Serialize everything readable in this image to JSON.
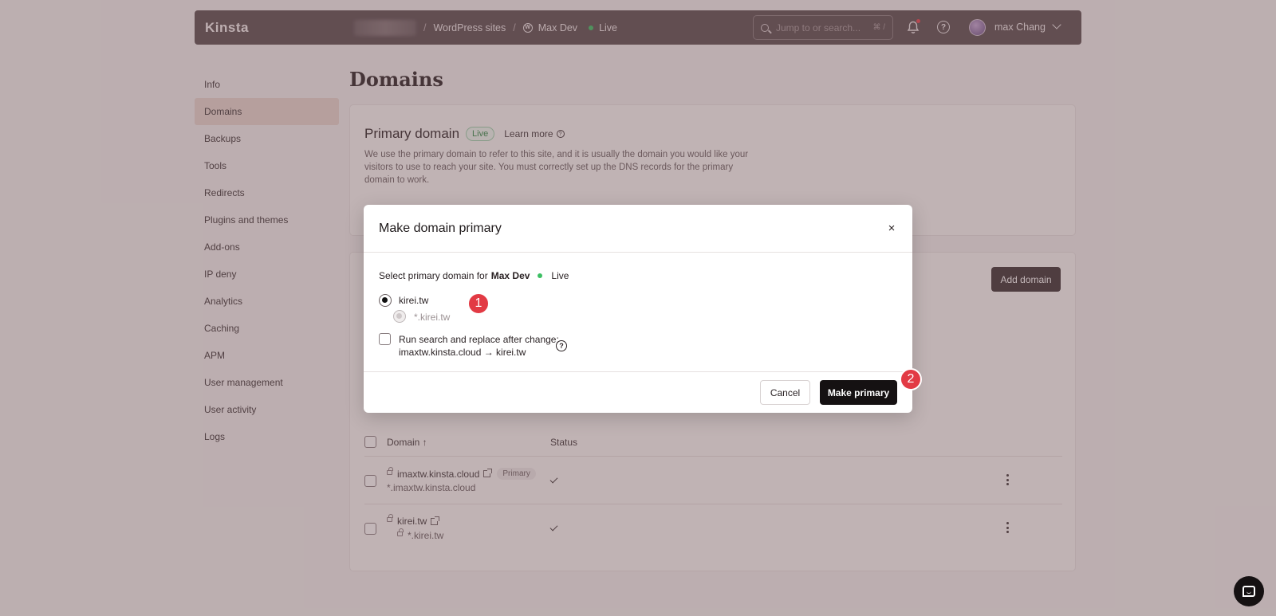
{
  "app": {
    "logo": "Kinsta"
  },
  "breadcrumb": {
    "section": "WordPress sites",
    "site": "Max Dev",
    "env": "Live"
  },
  "search": {
    "placeholder": "Jump to or search...",
    "shortcut": "⌘ /"
  },
  "user": {
    "name": "max Chang"
  },
  "sidebar": {
    "items": [
      {
        "label": "Info"
      },
      {
        "label": "Domains",
        "active": true
      },
      {
        "label": "Backups"
      },
      {
        "label": "Tools"
      },
      {
        "label": "Redirects"
      },
      {
        "label": "Plugins and themes"
      },
      {
        "label": "Add-ons"
      },
      {
        "label": "IP deny"
      },
      {
        "label": "Analytics"
      },
      {
        "label": "Caching"
      },
      {
        "label": "APM"
      },
      {
        "label": "User management"
      },
      {
        "label": "User activity"
      },
      {
        "label": "Logs"
      }
    ]
  },
  "page": {
    "title": "Domains"
  },
  "primary_domain": {
    "title": "Primary domain",
    "badge": "Live",
    "learn_more": "Learn more",
    "description": "We use the primary domain to refer to this site, and it is usually the domain you would like your visitors to use to reach your site. You must correctly set up the DNS records for the primary domain to work."
  },
  "domains": {
    "add_button": "Add domain",
    "columns": {
      "domain": "Domain ↑",
      "status": "Status"
    },
    "rows": [
      {
        "domain": "imaxtw.kinsta.cloud",
        "badge": "Primary",
        "wildcard": "*.imaxtw.kinsta.cloud"
      },
      {
        "domain": "kirei.tw",
        "wildcard": "*.kirei.tw"
      }
    ]
  },
  "modal": {
    "title": "Make domain primary",
    "close": "×",
    "select_prefix": "Select primary domain for",
    "site": "Max Dev",
    "env": "Live",
    "options": [
      {
        "label": "kirei.tw",
        "selected": true
      },
      {
        "label": "*.kirei.tw",
        "disabled": true
      }
    ],
    "replace_label": "Run search and replace after change:",
    "replace_detail": "imaxtw.kinsta.cloud → kirei.tw",
    "help": "?",
    "cancel": "Cancel",
    "confirm": "Make primary"
  },
  "steps": [
    "1",
    "2"
  ],
  "colors": {
    "accent": "#151112",
    "topbar": "#5a4c4f",
    "live": "#3cbf63",
    "step": "#e23a44"
  }
}
